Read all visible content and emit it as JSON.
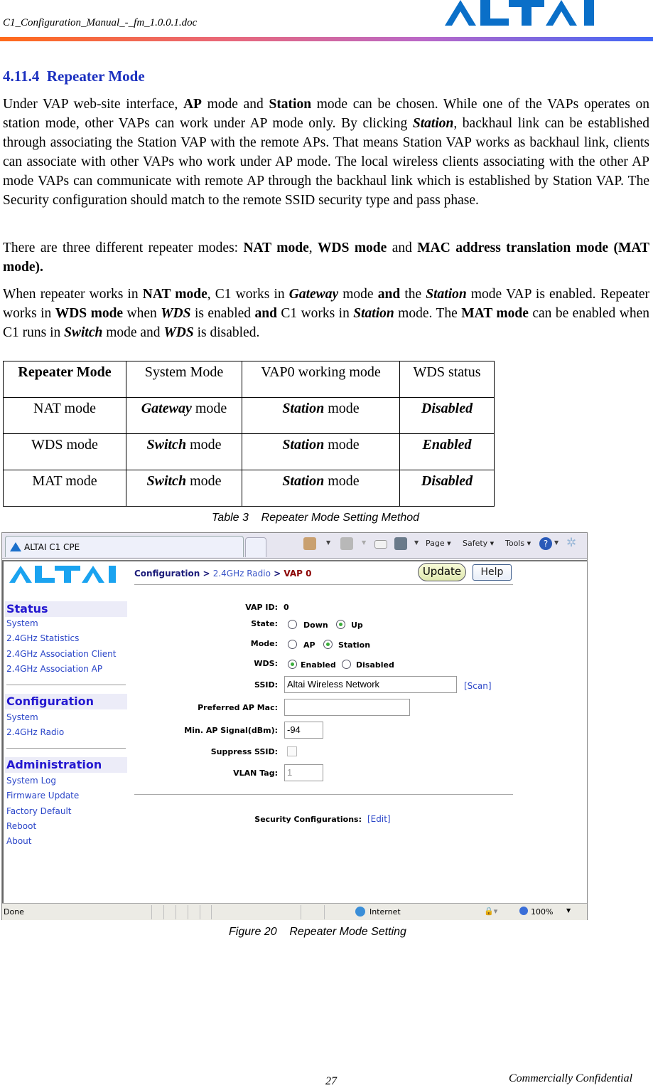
{
  "header": {
    "filename": "C1_Configuration_Manual_-_fm_1.0.0.1.doc",
    "logo_text": "ALTAI",
    "brand_color": "#0a6fc8"
  },
  "section": {
    "number": "4.11.4",
    "title": "Repeater Mode",
    "title_color": "#1a2fbf"
  },
  "paragraphs": {
    "p1": [
      {
        "t": "Under VAP web-site interface, "
      },
      {
        "t": "AP",
        "b": true
      },
      {
        "t": " mode and "
      },
      {
        "t": "Station",
        "b": true
      },
      {
        "t": " mode can be chosen. While one of the VAPs operates on station mode, other VAPs can work under AP mode only. By clicking "
      },
      {
        "t": "Station",
        "b": true,
        "i": true
      },
      {
        "t": ", backhaul link can be established through associating the Station VAP with the remote APs. That means Station VAP works as backhaul link, clients can associate with other VAPs who work under AP mode. The local wireless clients associating with the other AP mode VAPs can communicate with remote AP through the backhaul link which is established by Station VAP. The Security configuration should match to the remote SSID security type and pass phase."
      }
    ],
    "p2": [
      {
        "t": "There are three different repeater modes: "
      },
      {
        "t": "NAT mode",
        "b": true
      },
      {
        "t": ", "
      },
      {
        "t": "WDS mode",
        "b": true
      },
      {
        "t": " and "
      },
      {
        "t": "MAC address translation mode (MAT mode).",
        "b": true
      }
    ],
    "p3": [
      {
        "t": "When repeater works in "
      },
      {
        "t": "NAT mode",
        "b": true
      },
      {
        "t": ", C1 works in "
      },
      {
        "t": "Gateway",
        "b": true,
        "i": true
      },
      {
        "t": " mode "
      },
      {
        "t": "and",
        "b": true
      },
      {
        "t": " the "
      },
      {
        "t": "Station",
        "b": true,
        "i": true
      },
      {
        "t": " mode VAP is enabled. Repeater works in "
      },
      {
        "t": "WDS mode",
        "b": true
      },
      {
        "t": " when "
      },
      {
        "t": "WDS",
        "b": true,
        "i": true
      },
      {
        "t": " is enabled "
      },
      {
        "t": "and",
        "b": true
      },
      {
        "t": " C1 works in "
      },
      {
        "t": "Station",
        "b": true,
        "i": true
      },
      {
        "t": " mode. The "
      },
      {
        "t": "MAT mode",
        "b": true
      },
      {
        "t": " can be enabled when C1 runs in "
      },
      {
        "t": "Switch",
        "b": true,
        "i": true
      },
      {
        "t": " mode and "
      },
      {
        "t": "WDS",
        "b": true,
        "i": true
      },
      {
        "t": " is disabled."
      }
    ]
  },
  "table": {
    "headers": [
      "Repeater Mode",
      "System Mode",
      "VAP0 working mode",
      "WDS status"
    ],
    "rows": [
      {
        "mode": "NAT mode",
        "system_em": "Gateway",
        "system_rest": " mode",
        "vap_em": "Station",
        "vap_rest": " mode",
        "wds": "Disabled"
      },
      {
        "mode": "WDS mode",
        "system_em": "Switch",
        "system_rest": " mode",
        "vap_em": "Station",
        "vap_rest": " mode",
        "wds": "Enabled"
      },
      {
        "mode": "MAT mode",
        "system_em": "Switch",
        "system_rest": " mode",
        "vap_em": "Station",
        "vap_rest": " mode",
        "wds": "Disabled"
      }
    ],
    "caption": "Table 3    Repeater Mode Setting Method"
  },
  "browser": {
    "tab_title": "ALTAI C1 CPE",
    "toolbar": {
      "home_icon": "home-icon",
      "feeds_icon": "rss-icon",
      "mail_icon": "mail-icon",
      "print_icon": "printer-icon",
      "page_label": "Page",
      "safety_label": "Safety",
      "tools_label": "Tools",
      "help_icon": "help-icon",
      "settings_icon": "gear-icon"
    },
    "sidebar": {
      "logo_text": "ALTAI",
      "sections": [
        {
          "title": "Status",
          "items": [
            "System",
            "2.4GHz Statistics",
            "2.4GHz Association Client",
            "2.4GHz Association AP"
          ]
        },
        {
          "title": "Configuration",
          "items": [
            "System",
            "2.4GHz Radio"
          ]
        },
        {
          "title": "Administration",
          "items": [
            "System Log",
            "Firmware Update",
            "Factory Default",
            "Reboot",
            "About"
          ]
        }
      ]
    },
    "breadcrumb": {
      "root": "Configuration",
      "sep": " > ",
      "mid": "2.4GHz Radio",
      "last": "VAP 0"
    },
    "buttons": {
      "update": "Update",
      "help": "Help"
    },
    "form": {
      "vap_id_label": "VAP ID:",
      "vap_id_value": "0",
      "state_label": "State:",
      "state_options": [
        "Down",
        "Up"
      ],
      "state_selected": "Up",
      "mode_label": "Mode:",
      "mode_options": [
        "AP",
        "Station"
      ],
      "mode_selected": "Station",
      "wds_label": "WDS:",
      "wds_options": [
        "Enabled",
        "Disabled"
      ],
      "wds_selected": "Enabled",
      "ssid_label": "SSID:",
      "ssid_value": "Altai Wireless Network",
      "scan_link": "[Scan]",
      "pref_ap_label": "Preferred AP Mac:",
      "pref_ap_value": "",
      "min_signal_label": "Min. AP Signal(dBm):",
      "min_signal_value": "-94",
      "suppress_label": "Suppress SSID:",
      "suppress_checked": false,
      "vlan_label": "VLAN Tag:",
      "vlan_value": "1",
      "security_label": "Security Configurations:",
      "security_link": "[Edit]"
    },
    "statusbar": {
      "status": "Done",
      "zone": "Internet",
      "zoom": "100%"
    }
  },
  "figure_caption": "Figure 20    Repeater Mode Setting",
  "footer": {
    "page_number": "27",
    "confidential": "Commercially Confidential"
  }
}
